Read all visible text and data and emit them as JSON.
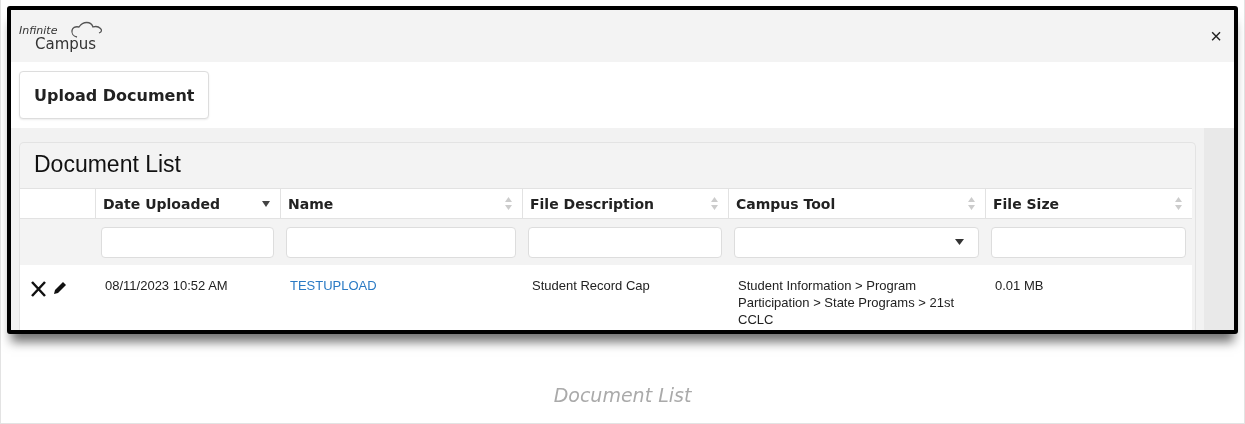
{
  "logo": {
    "line_1": "Infinite",
    "line_2": "Campus"
  },
  "close": "×",
  "upload_button": "Upload Document",
  "document_list": {
    "title": "Document List",
    "columns": [
      {
        "label": "Date Uploaded",
        "sorted": true,
        "kind": "text"
      },
      {
        "label": "Name",
        "sorted": false,
        "kind": "text"
      },
      {
        "label": "File Description",
        "sorted": false,
        "kind": "text"
      },
      {
        "label": "Campus Tool",
        "sorted": false,
        "kind": "select"
      },
      {
        "label": "File Size",
        "sorted": false,
        "kind": "text"
      }
    ],
    "rows": [
      {
        "date_uploaded": "08/11/2023 10:52 AM",
        "name": "TESTUPLOAD",
        "file_description": "Student Record Cap",
        "campus_tool": "Student Information > Program Participation > State Programs > 21st CCLC",
        "file_size": "0.01 MB"
      }
    ]
  },
  "caption": "Document List"
}
